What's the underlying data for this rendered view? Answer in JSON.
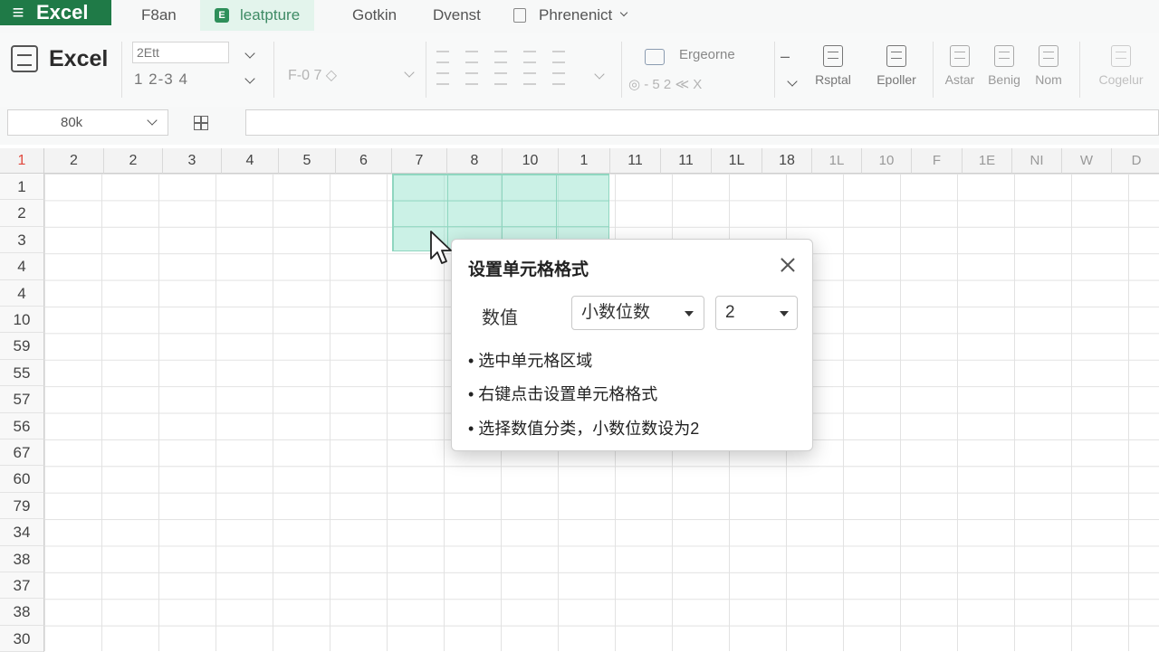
{
  "menubar": {
    "app_name": "Excel",
    "items": [
      {
        "label": "F8an"
      },
      {
        "label": "leatpture"
      },
      {
        "label": "Gotkin"
      },
      {
        "label": "Dvenst"
      },
      {
        "label": "Phrenenict"
      }
    ]
  },
  "ribbon": {
    "app_label": "Excel",
    "font_value": "2Ett",
    "size_row": "1 2-3 4",
    "align_group": "F-0 7 ◇",
    "style_label": "Ergeorne",
    "style_sub": "◎ - 5 2 ≪ X",
    "buttons": [
      {
        "label": "Rsptal"
      },
      {
        "label": "Epoller"
      },
      {
        "label": "Astar"
      },
      {
        "label": "Benig"
      },
      {
        "label": "Nom"
      },
      {
        "label": "Cogelur"
      }
    ]
  },
  "formula_bar": {
    "name_box": "80k",
    "formula": ""
  },
  "grid": {
    "corner": "1",
    "columns": [
      "2",
      "2",
      "3",
      "4",
      "5",
      "6",
      "7",
      "8",
      "10",
      "1",
      "11",
      "11",
      "1L",
      "18",
      "1L",
      "10",
      "F",
      "1E",
      "NI",
      "W",
      "D"
    ],
    "rows": [
      "1",
      "2",
      "3",
      "4",
      "4",
      "10",
      "59",
      "55",
      "57",
      "56",
      "67",
      "60",
      "79",
      "34",
      "38",
      "37",
      "38",
      "30"
    ]
  },
  "dialog": {
    "title": "设置单元格格式",
    "field_label": "数值",
    "category_select": "小数位数",
    "decimals_select": "2",
    "steps": [
      "• 选中单元格区域",
      "• 右键点击设置单元格格式",
      "• 选择数值分类，小数位数设为2"
    ]
  },
  "colors": {
    "brand": "#1f7a47",
    "selection": "#a0e6d2",
    "active_tab": "#e3f4ec",
    "corner_text": "#e0483e"
  },
  "icons": [
    "menu-icon",
    "sheet-icon",
    "document-icon",
    "excel-logo-icon",
    "chevron-down-icon",
    "close-icon",
    "pointer-cursor-icon",
    "insert-function-icon"
  ]
}
